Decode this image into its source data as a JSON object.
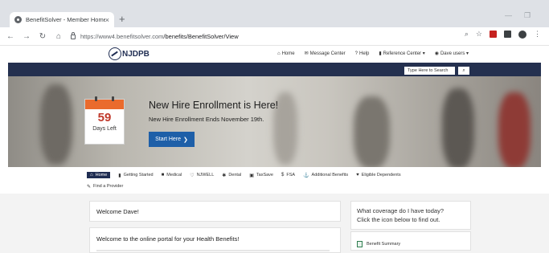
{
  "browser": {
    "tab_title": "BenefitSolver - Member Home",
    "tab_close": "×",
    "new_tab": "+",
    "url_host": "https://www4.benefitsolver.com",
    "url_path": "/benefits/BenefitSolver/View"
  },
  "site": {
    "logo_text": "NJDPB",
    "topnav": [
      {
        "label": "Home",
        "icon": "home-icon"
      },
      {
        "label": "Message Center",
        "icon": "envelope-icon"
      },
      {
        "label": "Help",
        "icon": "help-icon"
      },
      {
        "label": "Reference Center ▾",
        "icon": "book-icon"
      },
      {
        "label": "Dave users ▾",
        "icon": "user-icon"
      }
    ],
    "search_placeholder": "Type Here to Search"
  },
  "hero": {
    "days": "59",
    "days_label": "Days Left",
    "title": "New Hire Enrollment is Here!",
    "subtitle": "New Hire Enrollment Ends November 19th.",
    "cta": "Start Here"
  },
  "subnav": {
    "row1": [
      {
        "label": "Home",
        "icon": "home-icon",
        "active": true
      },
      {
        "label": "Getting Started",
        "icon": "bookmark-icon"
      },
      {
        "label": "Medical",
        "icon": "medkit-icon"
      },
      {
        "label": "NJWELL",
        "icon": "heartbeat-icon"
      },
      {
        "label": "Dental",
        "icon": "tooth-icon"
      },
      {
        "label": "TaxSave",
        "icon": "money-icon"
      },
      {
        "label": "FSA",
        "icon": "dollar-icon"
      },
      {
        "label": "Additional Benefits",
        "icon": "anchor-icon"
      },
      {
        "label": "Eligible Dependents",
        "icon": "heart-icon"
      }
    ],
    "row2": [
      {
        "label": "Find a Provider",
        "icon": "pen-icon"
      }
    ]
  },
  "content": {
    "welcome": "Welcome Dave!",
    "portal": "Welcome to the online portal for your Health Benefits!",
    "coverage_q": "What coverage do I have today?",
    "coverage_hint": "Click the icon below to find out.",
    "summary_label": "Benefit Summary"
  }
}
